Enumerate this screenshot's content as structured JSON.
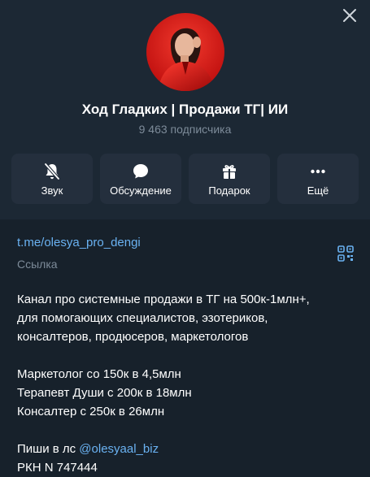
{
  "channel": {
    "title": "Ход Гладких | Продажи ТГ| ИИ",
    "subscribers": "9 463 подписчика"
  },
  "actions": [
    {
      "label": "Звук",
      "icon": "bell-off-icon"
    },
    {
      "label": "Обсуждение",
      "icon": "chat-bubble-icon"
    },
    {
      "label": "Подарок",
      "icon": "gift-icon"
    },
    {
      "label": "Ещё",
      "icon": "more-dots-icon"
    }
  ],
  "info": {
    "link": "t.me/olesya_pro_dengi",
    "link_label": "Ссылка",
    "description_lines": [
      "Канал про системные продажи в ТГ на 500к-1млн+,",
      "для помогающих специалистов, эзотериков,",
      "консалтеров, продюсеров, маркетологов"
    ],
    "cases": [
      "Маркетолог со 150к в 4,5млн",
      "Терапевт Души с 200к в 18млн",
      "Консалтер с 250к в 26млн"
    ],
    "contact_prefix": "Пиши в лс ",
    "contact_mention": "@olesyaal_biz",
    "registry": "РКН N 747444"
  },
  "colors": {
    "background": "#17212b",
    "header": "#1c2834",
    "button": "#242f3d",
    "accent": "#6ab2f2",
    "muted": "#7d8b99",
    "avatar_bg": "#e02020"
  }
}
